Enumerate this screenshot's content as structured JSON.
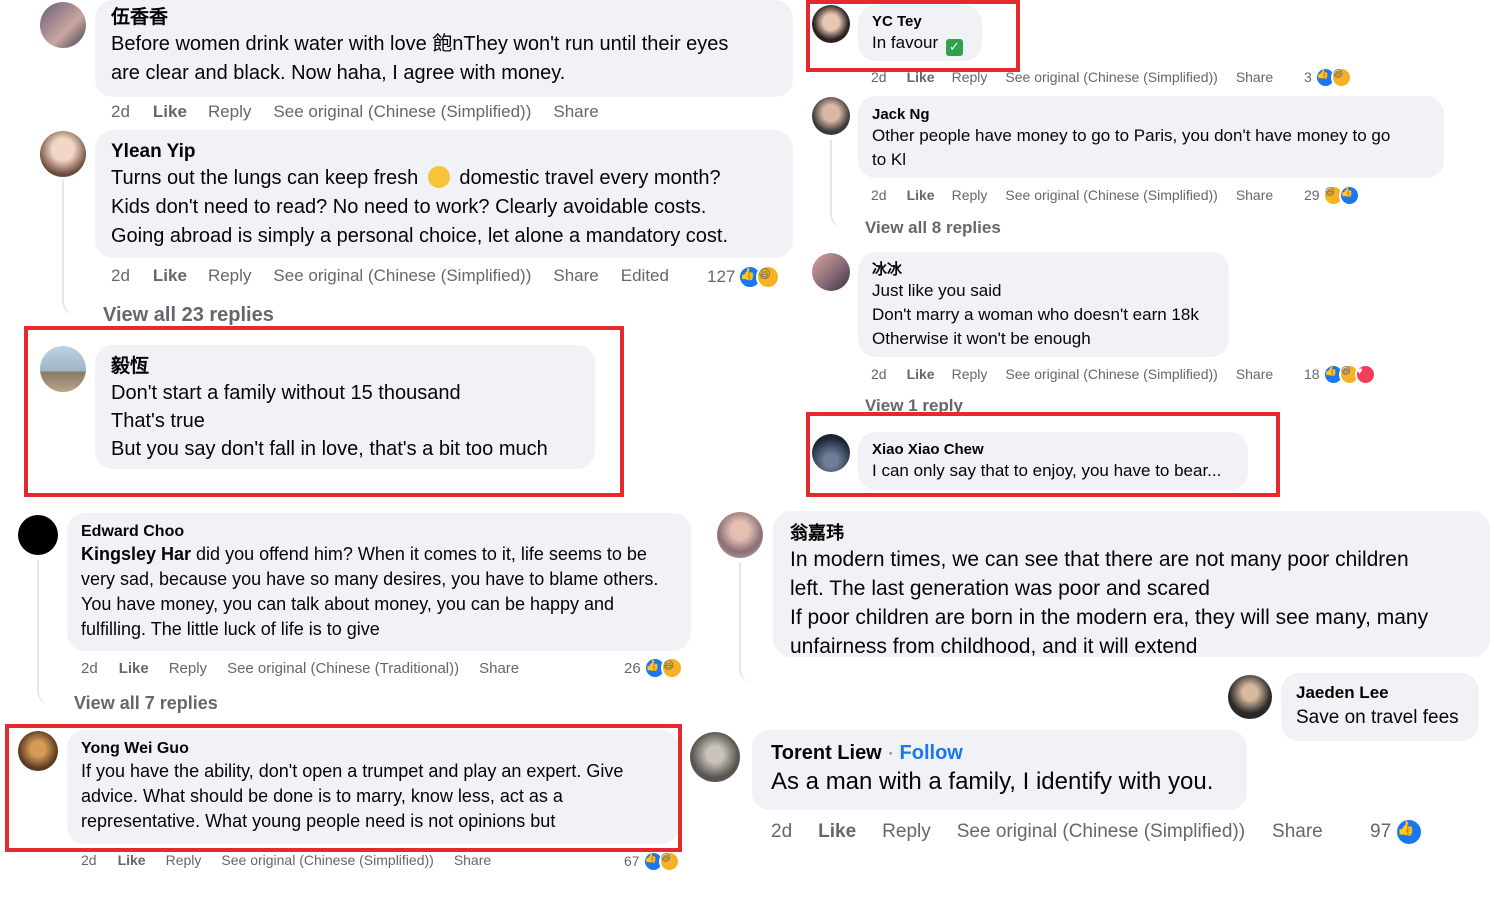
{
  "colors": {
    "highlight": "#e5292f",
    "bubble": "#f0f2f5",
    "meta": "#65676b",
    "link": "#1877f2"
  },
  "left": {
    "c1": {
      "name": "伍香香",
      "text1": "Before women drink water with love 飽nThey won't run until their eyes",
      "text2": "are clear and black. Now haha, I agree with money.",
      "time": "2d",
      "like": "Like",
      "reply": "Reply",
      "see": "See original (Chinese (Simplified))",
      "share": "Share"
    },
    "c2": {
      "name": "Ylean Yip",
      "text1": "Turns out the lungs can keep fresh",
      "emoji": "sweat-smile-icon",
      "text1b": "domestic travel every month?",
      "text2": "Kids don't need to read? No need to work? Clearly avoidable costs.",
      "text3": "Going abroad is simply a personal choice, let alone a mandatory cost.",
      "time": "2d",
      "like": "Like",
      "reply": "Reply",
      "see": "See original (Chinese (Simplified))",
      "share": "Share",
      "edited": "Edited",
      "count": "127",
      "view": "View all 23 replies"
    },
    "c3": {
      "name": "毅恆",
      "text1": "Don't start a family without 15 thousand",
      "text2": "That's true",
      "text3": "But you say don't fall in love, that's a bit too much"
    }
  },
  "right": {
    "c1": {
      "name": "YC Tey",
      "text": "In favour",
      "time": "2d",
      "like": "Like",
      "reply": "Reply",
      "see": "See original (Chinese (Simplified))",
      "share": "Share",
      "count": "3"
    },
    "c2": {
      "name": "Jack Ng",
      "text1": "Other people have money to go to Paris, you don't have money to go",
      "text2": "to Kl",
      "time": "2d",
      "like": "Like",
      "reply": "Reply",
      "see": "See original (Chinese (Simplified))",
      "share": "Share",
      "count": "29",
      "view": "View all 8 replies"
    },
    "c3": {
      "name": "冰冰",
      "text1": "Just like you said",
      "text2": "Don't marry a woman who doesn't earn 18k",
      "text3": "Otherwise it won't be enough",
      "time": "2d",
      "like": "Like",
      "reply": "Reply",
      "see": "See original (Chinese (Simplified))",
      "share": "Share",
      "count": "18",
      "view": "View 1 reply"
    },
    "c4": {
      "name": "Xiao Xiao Chew",
      "text": "I can only say that to enjoy, you have to bear..."
    }
  },
  "midleft": {
    "c1": {
      "name": "Edward Choo",
      "mention": "Kingsley Har",
      "text1": " did you offend him? When it comes to it, life seems to be",
      "text2": "very sad, because you have so many desires, you have to blame others.",
      "text3": "You have money, you can talk about money, you can be happy and",
      "text4": "fulfilling. The little luck of life is to give",
      "time": "2d",
      "like": "Like",
      "reply": "Reply",
      "see": "See original (Chinese (Traditional))",
      "share": "Share",
      "count": "26",
      "view": "View all 7 replies"
    },
    "c2": {
      "name": "Yong Wei Guo",
      "text1": "If you have the ability, don't open a trumpet and play an expert. Give",
      "text2": "advice. What should be done is to marry, know less, act as a",
      "text3": "representative. What young people need is not opinions but",
      "time": "2d",
      "like": "Like",
      "reply": "Reply",
      "see": "See original (Chinese (Simplified))",
      "share": "Share",
      "count": "67"
    }
  },
  "midright": {
    "c1": {
      "name": "翁嘉玮",
      "text1": "In modern times, we can see that there are not many poor children",
      "text2": "left. The last generation was poor and scared",
      "text3": "If poor children are born in the modern era, they will see many, many",
      "text4": "unfairness from childhood, and it will extend"
    },
    "c2": {
      "name": "Jaeden Lee",
      "text": "Save on travel fees"
    },
    "c3": {
      "name": "Torent Liew",
      "sep": " · ",
      "follow": "Follow",
      "text": "As a man with a family, I identify with you.",
      "time": "2d",
      "like": "Like",
      "reply": "Reply",
      "see": "See original (Chinese (Simplified))",
      "share": "Share",
      "count": "97"
    }
  }
}
